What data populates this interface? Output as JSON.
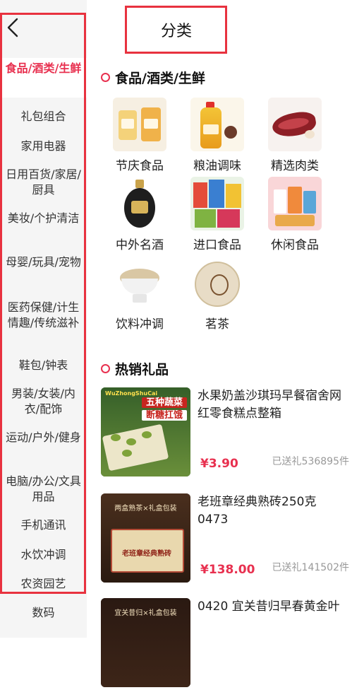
{
  "header": {
    "title": "分类"
  },
  "sidebar": {
    "items": [
      {
        "label": "食品/酒类/生鲜",
        "active": true
      },
      {
        "label": "礼包组合"
      },
      {
        "label": "家用电器"
      },
      {
        "label": "日用百货/家居/厨具"
      },
      {
        "label": "美妆/个护清洁"
      },
      {
        "label": "母婴/玩具/宠物"
      },
      {
        "label": "医药保健/计生情趣/传统滋补"
      },
      {
        "label": "鞋包/钟表"
      },
      {
        "label": "男装/女装/内衣/配饰"
      },
      {
        "label": "运动/户外/健身"
      },
      {
        "label": "电脑/办公/文具用品"
      },
      {
        "label": "手机通讯"
      },
      {
        "label": "水饮冲调"
      },
      {
        "label": "农资园艺"
      },
      {
        "label": "数码"
      }
    ]
  },
  "category_section": {
    "title": "食品/酒类/生鲜",
    "items": [
      {
        "label": "节庆食品",
        "icon": "festive-food-icon"
      },
      {
        "label": "粮油调味",
        "icon": "cooking-oil-icon"
      },
      {
        "label": "精选肉类",
        "icon": "ham-meat-icon"
      },
      {
        "label": "中外名酒",
        "icon": "liquor-bottle-icon"
      },
      {
        "label": "进口食品",
        "icon": "imported-snacks-icon"
      },
      {
        "label": "休闲食品",
        "icon": "snack-bags-icon"
      },
      {
        "label": "饮料冲调",
        "icon": "oatmeal-bowl-icon"
      },
      {
        "label": "茗茶",
        "icon": "tea-cake-icon"
      }
    ]
  },
  "hot_section": {
    "title": "热销礼品",
    "products": [
      {
        "title": "水果奶盖沙琪玛早餐宿舍网红零食糕点整箱",
        "price": "¥3.90",
        "sold": "已送礼536895件",
        "img_text_top": "WuZhongShuCai",
        "img_text_main": "五种蔬菜",
        "img_text_sub": "断糖扛饿"
      },
      {
        "title": "老班章经典熟砖250克 0473",
        "price": "¥138.00",
        "sold": "已送礼141502件",
        "img_text_top": "两盒熟茶×礼盒包装",
        "img_text_main": "老班章经典熟砖"
      },
      {
        "title": "0420 宜关昔归早春黄金叶",
        "price": "",
        "sold": "",
        "img_text_top": "宜关昔归×礼盒包装"
      }
    ]
  },
  "colors": {
    "accent": "#e8304f",
    "highlight_box": "#e8323f",
    "sidebar_bg": "#f5f5f5"
  }
}
